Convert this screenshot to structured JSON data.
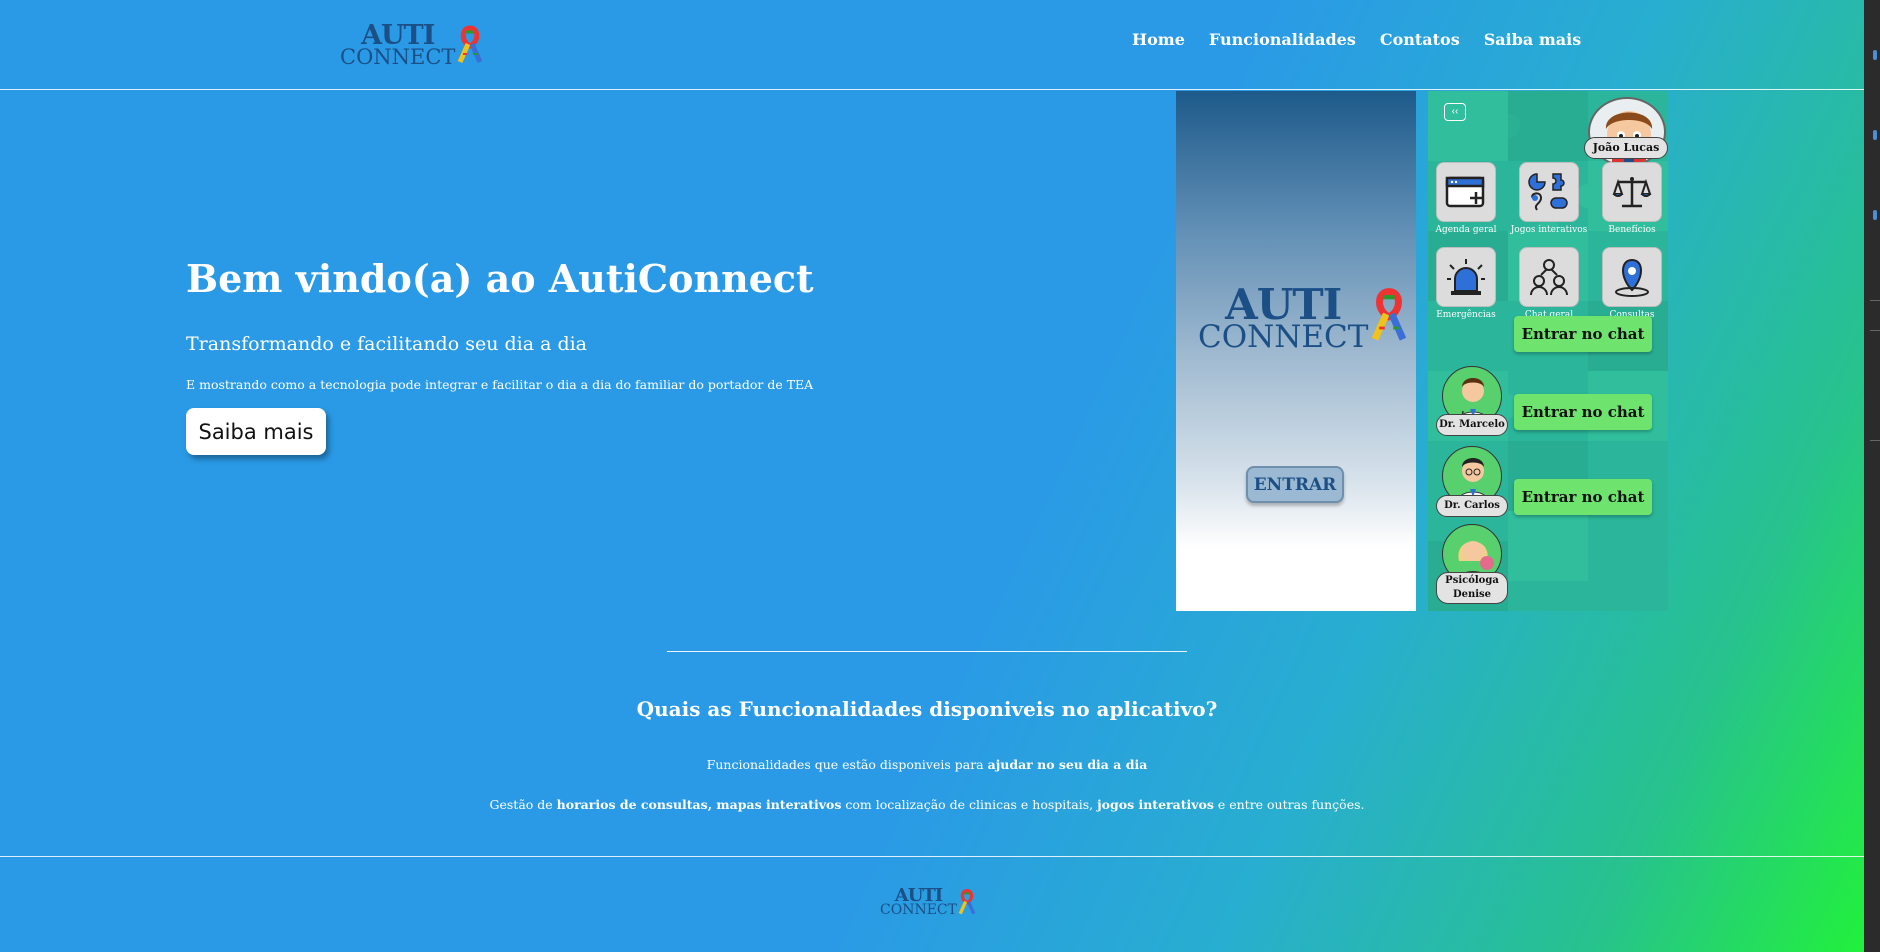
{
  "brand": {
    "line1": "AUTI",
    "line2": "CONNECT",
    "primary_color": "#1b4f86",
    "ribbon": "autism-awareness-ribbon-icon"
  },
  "nav": {
    "items": [
      "Home",
      "Funcionalidades",
      "Contatos",
      "Saiba mais"
    ]
  },
  "hero": {
    "title": "Bem vindo(a) ao AutiConnect",
    "subtitle": "Transformando e facilitando seu dia a dia",
    "description": "E mostrando como a tecnologia pode integrar e facilitar o dia a dia do familiar do portador de TEA",
    "button": "Saiba mais"
  },
  "login_preview": {
    "enter_button": "ENTRAR"
  },
  "app_preview": {
    "back_icon": "double-chevron-left-icon",
    "user_name": "João Lucas",
    "tiles": [
      {
        "label": "Agenda geral",
        "icon": "calendar-add-icon"
      },
      {
        "label": "Jogos interativos",
        "icon": "games-icon"
      },
      {
        "label": "Benefícios",
        "icon": "scale-icon"
      },
      {
        "label": "Emergências",
        "icon": "siren-icon"
      },
      {
        "label": "Chat geral",
        "icon": "group-icon"
      },
      {
        "label": "Consultas",
        "icon": "location-pin-icon"
      }
    ],
    "doctors": [
      {
        "name": "Dr. Marcelo",
        "button": "Entrar no chat"
      },
      {
        "name": "Dr. Carlos",
        "button": "Entrar no chat"
      },
      {
        "name_line1": "Psicóloga",
        "name_line2": "Denise",
        "button": "Entrar no chat"
      }
    ]
  },
  "features": {
    "title": "Quais as Funcionalidades disponiveis no aplicativo?",
    "line1_a": "Funcionalidades que estão disponiveis para ",
    "line1_b": "ajudar no seu dia a dia",
    "line2_a": "Gestão de ",
    "line2_b": "horarios de consultas, mapas interativos",
    "line2_c": " com localização de clinicas e hospitais, ",
    "line2_d": "jogos interativos",
    "line2_e": " e entre outras funções."
  },
  "colors": {
    "bg_start": "#2a9ae6",
    "bg_end": "#22f03c",
    "chat_button": "#6ee36d",
    "app_bg": "#29b39a"
  }
}
